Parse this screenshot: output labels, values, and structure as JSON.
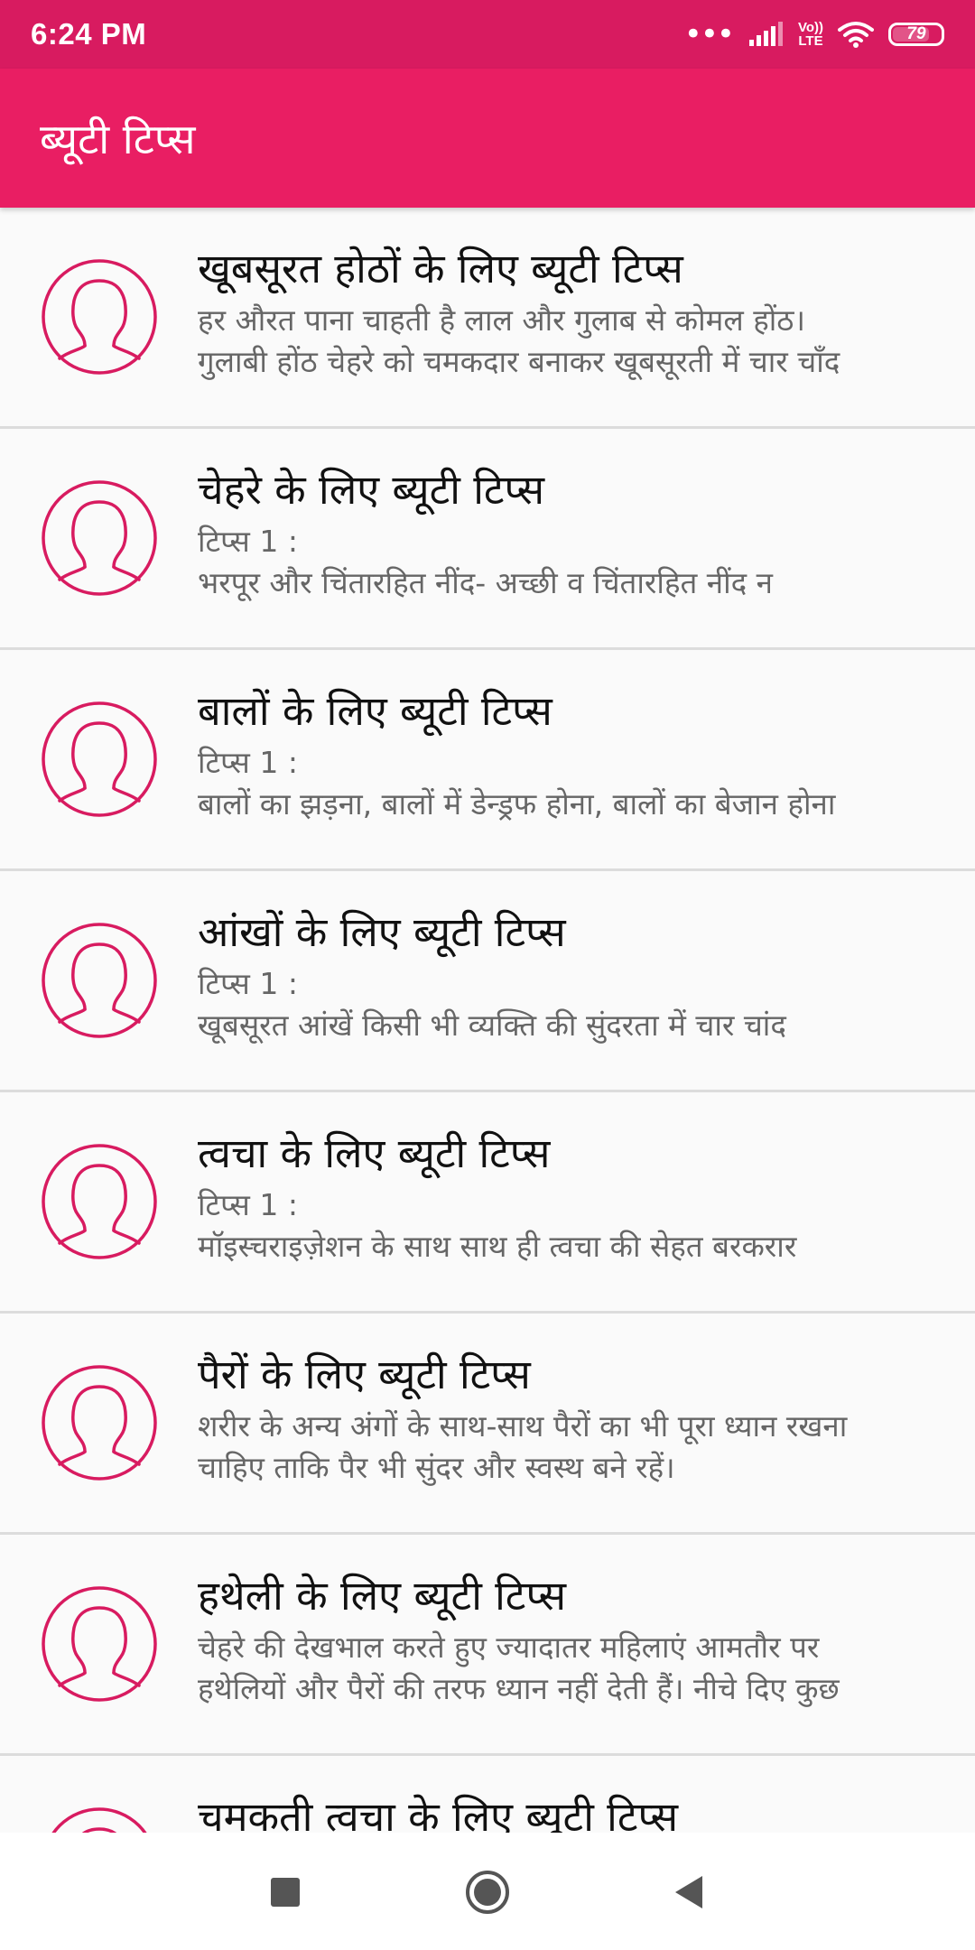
{
  "status_bar": {
    "time": "6:24 PM",
    "dots": "•••",
    "volte_top": "Vo))",
    "volte_bottom": "LTE",
    "battery_level": 79,
    "battery_text": "79",
    "icons": [
      "signal-icon",
      "volte-icon",
      "wifi-icon",
      "battery-icon"
    ]
  },
  "app_bar": {
    "title": "ब्यूटी टिप्स"
  },
  "colors": {
    "status_bar": "#d81b60",
    "app_bar": "#e91e63",
    "accent": "#d81b60"
  },
  "list": {
    "items": [
      {
        "title": "खूबसूरत होठों के लिए ब्यूटी टिप्स",
        "line1": "हर औरत पाना चाहती है लाल और गुलाब से कोमल होंठ।",
        "line2": "गुलाबी होंठ चेहरे को चमकदार बनाकर खूबसूरती में चार चाँद"
      },
      {
        "title": "चेहरे के लिए ब्यूटी टिप्स",
        "line1": "टिप्स 1 :",
        "line2": "भरपूर और चिंतारहित नींद- अच्छी व चिंतारहित नींद न"
      },
      {
        "title": "बालों के लिए ब्यूटी टिप्स",
        "line1": "टिप्स 1 :",
        "line2": "बालों का झड़ना, बालों में डेन्ड्रफ होना, बालों का बेजान होना"
      },
      {
        "title": "आंखों के लिए ब्यूटी टिप्स",
        "line1": "टिप्स 1 :",
        "line2": "खूबसूरत आंखें किसी भी व्यक्ति की सुंदरता में चार चांद"
      },
      {
        "title": "त्वचा के लिए ब्यूटी टिप्स",
        "line1": "टिप्स 1 :",
        "line2": "मॉइस्चराइज़ेशन के साथ साथ ही त्वचा की सेहत बरकरार"
      },
      {
        "title": "पैरों के लिए ब्यूटी टिप्स",
        "line1": "शरीर के अन्य अंगों के साथ-साथ पैरों का भी पूरा ध्यान रखना",
        "line2": "चाहिए ताकि पैर भी सुंदर और स्वस्थ बने रहें।"
      },
      {
        "title": "हथेली के लिए ब्यूटी टिप्स",
        "line1": "चेहरे की देखभाल करते हुए ज्यादातर महिलाएं आमतौर पर",
        "line2": "हथेलियों और पैरों की तरफ ध्यान नहीं देती हैं। नीचे दिए कुछ"
      },
      {
        "title": "चमकती त्वचा के लिए ब्यूटी टिप्स",
        "line1": "",
        "line2": ""
      }
    ]
  },
  "nav_bar": {
    "buttons": [
      "recents-button",
      "home-button",
      "back-button"
    ]
  }
}
